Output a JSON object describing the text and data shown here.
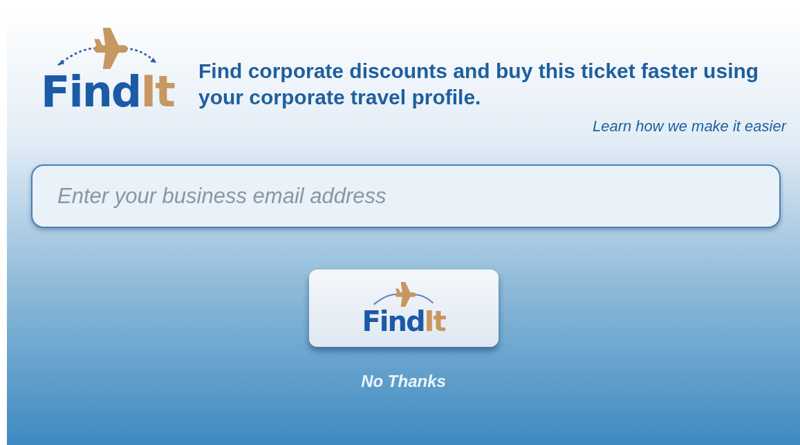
{
  "logo": {
    "primary": "Find",
    "accent": "It"
  },
  "headline": "Find corporate discounts and buy this ticket faster using your corporate travel profile.",
  "learn_link": "Learn how we make it easier",
  "email_field": {
    "placeholder": "Enter your business email address"
  },
  "findit_button": {
    "primary": "Find",
    "accent": "It"
  },
  "no_thanks_link": "No Thanks"
}
